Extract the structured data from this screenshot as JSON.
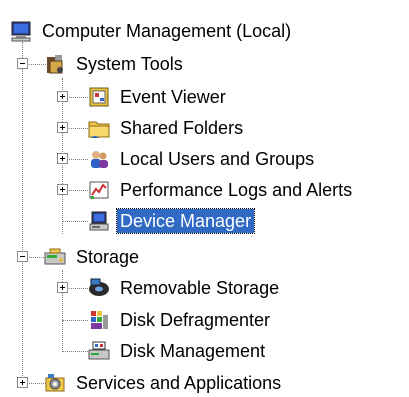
{
  "tree": {
    "root": "Computer Management (Local)",
    "system_tools": "System Tools",
    "event_viewer": "Event Viewer",
    "shared_folders": "Shared Folders",
    "local_users": "Local Users and Groups",
    "perf_logs": "Performance Logs and Alerts",
    "device_manager": "Device Manager",
    "storage": "Storage",
    "removable_storage": "Removable Storage",
    "disk_defrag": "Disk Defragmenter",
    "disk_management": "Disk Management",
    "services_apps": "Services and Applications"
  },
  "state": {
    "selected_node": "Device Manager",
    "expanded": [
      "System Tools",
      "Storage"
    ],
    "collapsed": [
      "Event Viewer",
      "Shared Folders",
      "Local Users and Groups",
      "Performance Logs and Alerts",
      "Removable Storage",
      "Services and Applications"
    ]
  },
  "colors": {
    "selection": "#316ac5",
    "tree_lines": "#808080"
  }
}
